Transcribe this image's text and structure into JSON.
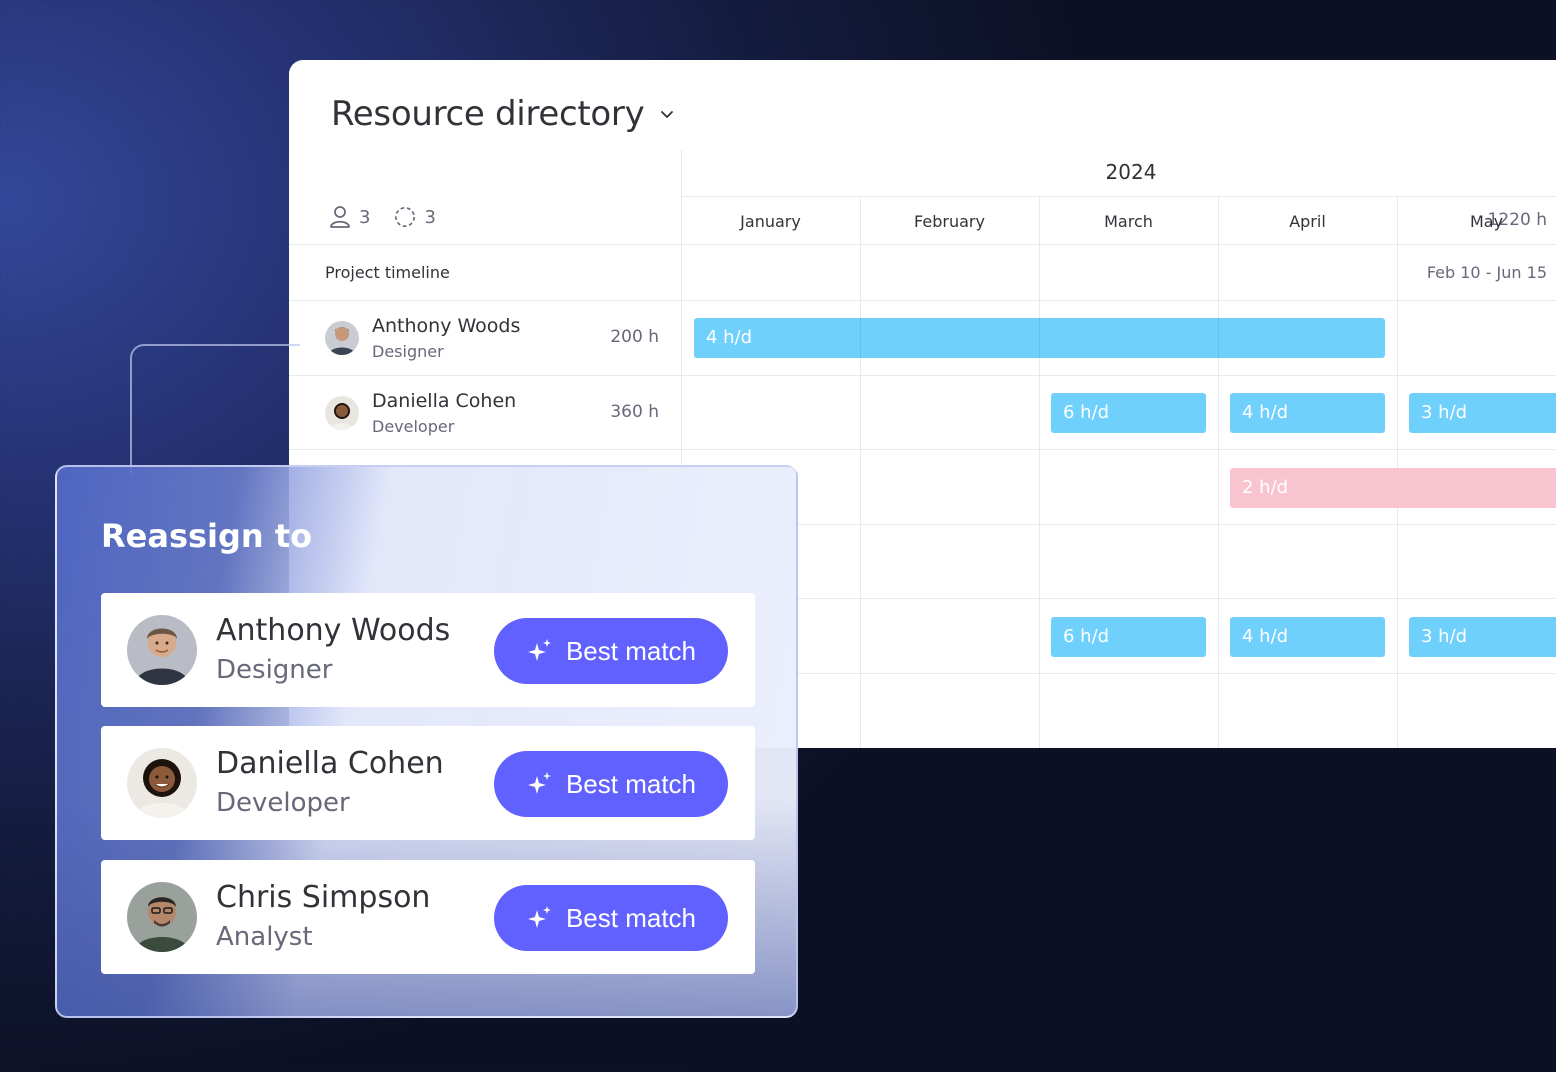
{
  "board": {
    "title": "Resource directory",
    "people_count": "3",
    "placeholder_count": "3",
    "total_hours": "1220 h",
    "timeline_label": "Project timeline",
    "timeline_range": "Feb 10 - Jun 15",
    "year": "2024",
    "months": [
      "January",
      "February",
      "March",
      "April",
      "May"
    ],
    "rows": [
      {
        "name": "Anthony Woods",
        "role": "Designer",
        "hours": "200 h"
      },
      {
        "name": "Daniella Cohen",
        "role": "Developer",
        "hours": "360 h"
      }
    ],
    "bars": {
      "row1": [
        "4 h/d"
      ],
      "row2": [
        "6 h/d",
        "4 h/d",
        "3 h/d"
      ],
      "row3": [
        "2 h/d"
      ],
      "row5": [
        "6 h/d",
        "4 h/d",
        "3 h/d"
      ]
    }
  },
  "panel": {
    "title": "Reassign to",
    "candidates": [
      {
        "name": "Anthony Woods",
        "role": "Designer",
        "action": "Best match"
      },
      {
        "name": "Daniella Cohen",
        "role": "Developer",
        "action": "Best match"
      },
      {
        "name": "Chris Simpson",
        "role": "Analyst",
        "action": "Best match"
      }
    ]
  },
  "colors": {
    "accent": "#6161ff",
    "bar_blue": "#6fd0fb",
    "bar_pink": "#f8c4cf",
    "text_primary": "#323338",
    "text_secondary": "#676879"
  },
  "icons": {
    "people": "person-icon",
    "placeholder": "dashed-circle-icon",
    "dropdown": "chevron-down-icon",
    "best_match": "sparkle-icon"
  }
}
